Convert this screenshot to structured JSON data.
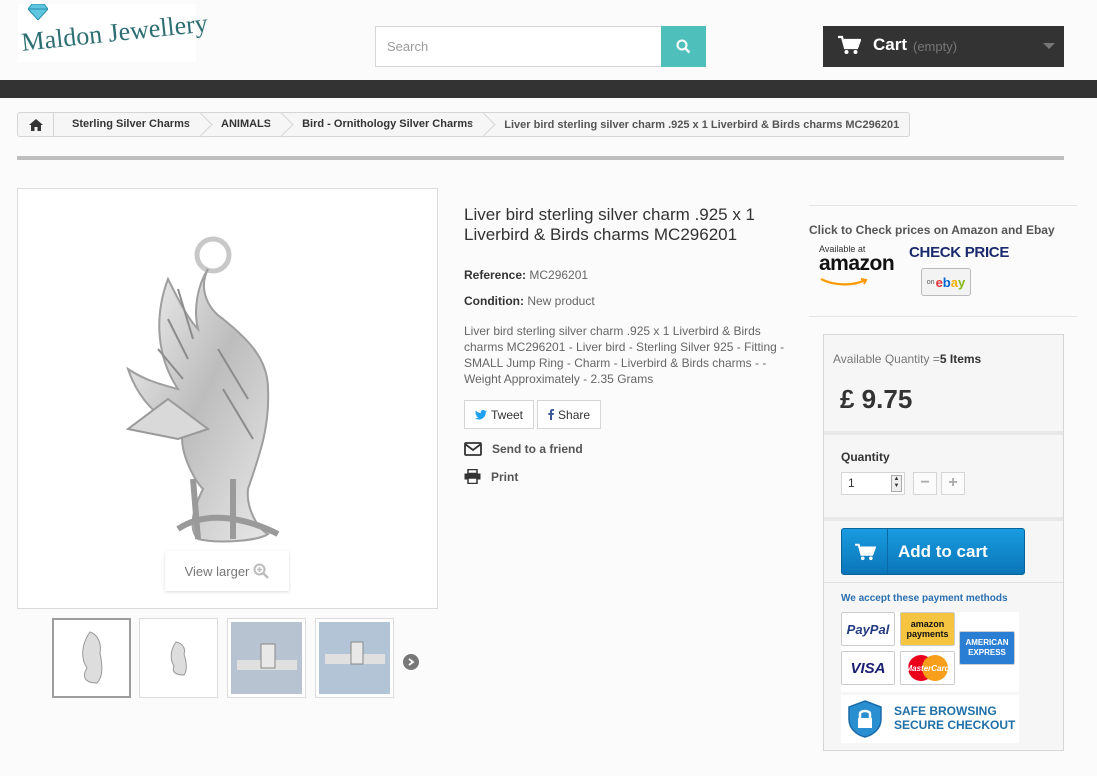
{
  "header": {
    "logo_text": "Maldon Jewellery",
    "search_placeholder": "Search",
    "cart_label": "Cart",
    "cart_status": "(empty)"
  },
  "breadcrumb": {
    "items": [
      "Sterling Silver Charms",
      "ANIMALS",
      "Bird - Ornithology Silver Charms"
    ],
    "current": "Liver bird sterling silver charm .925 x 1 Liverbird & Birds charms MC296201"
  },
  "gallery": {
    "view_larger": "View larger"
  },
  "product": {
    "title": "Liver bird sterling silver charm .925 x 1 Liverbird & Birds charms MC296201",
    "reference_label": "Reference:",
    "reference_value": "MC296201",
    "condition_label": "Condition:",
    "condition_value": "New product",
    "description": "Liver bird sterling silver charm .925 x 1 Liverbird & Birds charms MC296201 - Liver bird - Sterling Silver 925 - Fitting - SMALL Jump Ring - Charm - Liverbird & Birds charms - - Weight Approximately - 2.35 Grams",
    "tweet_label": "Tweet",
    "share_label": "Share",
    "send_friend_label": "Send to a friend",
    "print_label": "Print"
  },
  "sidebar": {
    "check_prices_text": "Click to Check prices on Amazon and Ebay",
    "amazon_available": "Available at",
    "amazon_name": "amazon",
    "check_price_label": "CHECK PRICE",
    "ebay_prefix": "on",
    "ebay_name": "ebay"
  },
  "buybox": {
    "available_quantity_label": "Available Quantity =",
    "available_quantity_value": "5 Items",
    "price": "£ 9.75",
    "quantity_label": "Quantity",
    "quantity_value": "1",
    "add_to_cart_label": "Add to cart",
    "payment_title": "We accept these payment methods",
    "payment_methods": [
      "PayPal",
      "amazon payments",
      "AMERICAN EXPRESS",
      "VISA",
      "MasterCard"
    ],
    "secure_line1": "SAFE BROWSING",
    "secure_line2": "SECURE CHECKOUT"
  },
  "colors": {
    "accent_teal": "#4fbfbb",
    "dark_bar": "#333333",
    "add_cart_blue": "#0f8fd0"
  }
}
